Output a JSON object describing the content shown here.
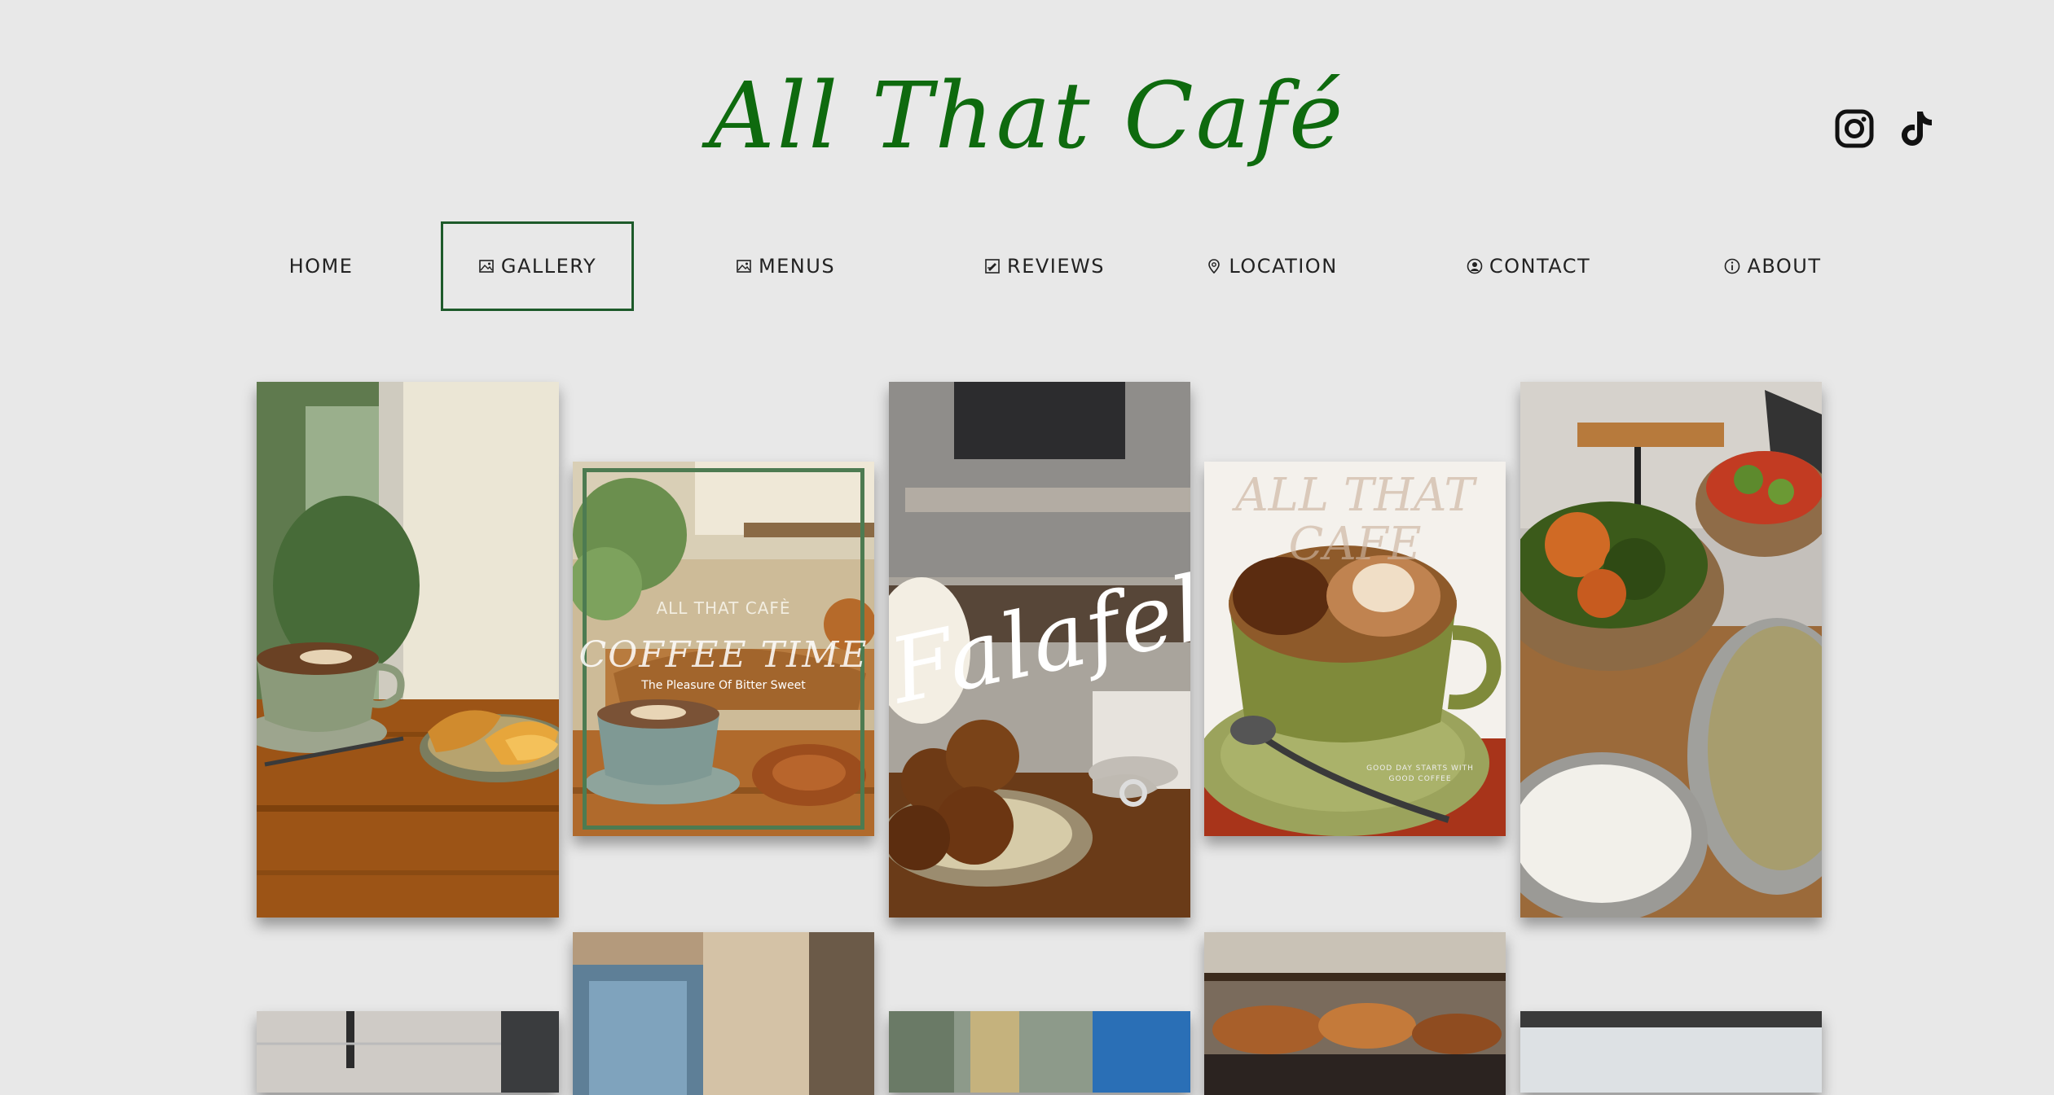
{
  "header": {
    "title": "All That Café",
    "social": [
      {
        "name": "instagram-icon"
      },
      {
        "name": "tiktok-icon"
      }
    ]
  },
  "nav": {
    "items": [
      {
        "label": "HOME",
        "icon": "",
        "active": false
      },
      {
        "label": "GALLERY",
        "icon": "image-icon",
        "active": true
      },
      {
        "label": "MENUS",
        "icon": "image-icon",
        "active": false
      },
      {
        "label": "REVIEWS",
        "icon": "review-icon",
        "active": false
      },
      {
        "label": "LOCATION",
        "icon": "location-pin-icon",
        "active": false
      },
      {
        "label": "CONTACT",
        "icon": "contact-icon",
        "active": false
      },
      {
        "label": "ABOUT",
        "icon": "info-icon",
        "active": false
      }
    ]
  },
  "gallery": {
    "photos": [
      {
        "name": "photo-latte-croissants"
      },
      {
        "name": "photo-coffee-time-poster",
        "brand": "ALL THAT CAFÈ",
        "headline": "COFFEE TIME",
        "tagline": "The Pleasure Of Bitter Sweet"
      },
      {
        "name": "photo-falafel",
        "overlay": "Falafel"
      },
      {
        "name": "photo-latte-mocha",
        "overlay": "ALL THAT CAFE",
        "caption_line1": "GOOD DAY STARTS WITH",
        "caption_line2": "GOOD COFFEE"
      },
      {
        "name": "photo-salads"
      },
      {
        "name": "photo-row2-1"
      },
      {
        "name": "photo-row2-2"
      },
      {
        "name": "photo-row2-3"
      },
      {
        "name": "photo-row2-4"
      },
      {
        "name": "photo-row2-5"
      }
    ]
  },
  "colors": {
    "brand_green": "#0e6a0e",
    "active_border": "#1d5a2a",
    "background": "#e8e8e8"
  }
}
